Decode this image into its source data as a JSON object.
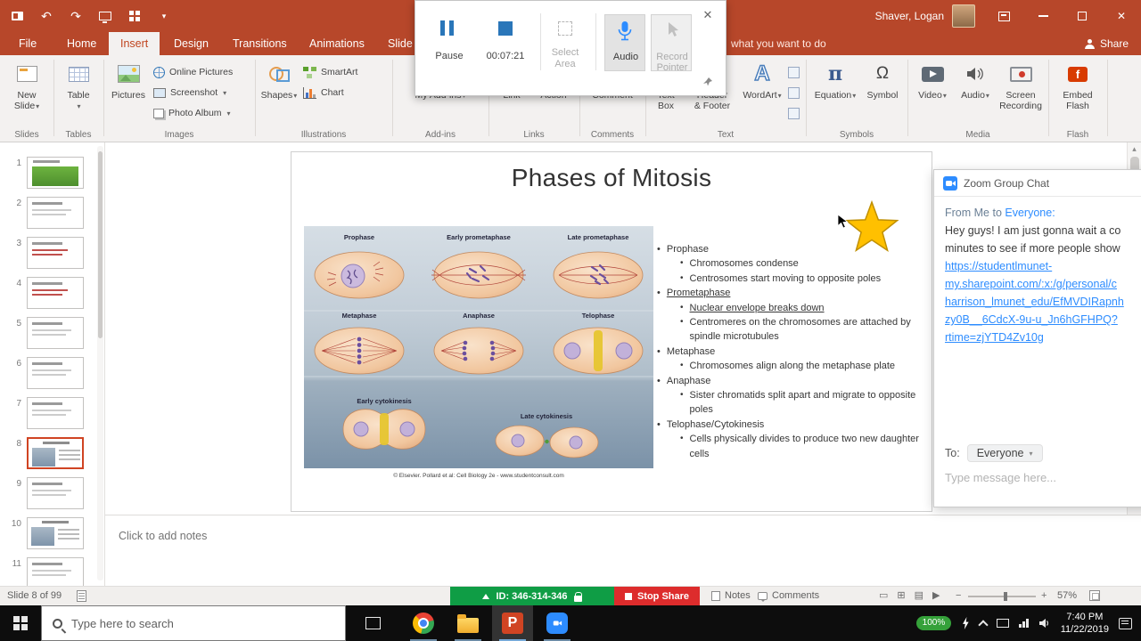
{
  "icons": {
    "close": "✕",
    "dropdown": "▾",
    "undo": "↶",
    "redo": "↷",
    "equation_pi": "π",
    "symbol_omega": "Ω",
    "wordart_a": "A",
    "ppt_p": "P",
    "flash_f": "f",
    "zoom_out": "−",
    "zoom_in": "+",
    "scroll_up": "▴",
    "view_normal": "▭",
    "view_sorter": "⊞",
    "view_reading": "▤",
    "view_slideshow": "▶"
  },
  "titlebar": {
    "user_name": "Shaver, Logan"
  },
  "tabs": {
    "file": "File",
    "home": "Home",
    "insert": "Insert",
    "design": "Design",
    "transitions": "Transitions",
    "animations": "Animations",
    "slideshow": "Slide Show",
    "tellme": "what you want to do",
    "share": "Share"
  },
  "recorder": {
    "pause": "Pause",
    "timer": "00:07:21",
    "select1": "Select",
    "select2": "Area",
    "audio": "Audio",
    "pointer1": "Record",
    "pointer2": "Pointer"
  },
  "ribbon": {
    "slides": {
      "label": "Slides",
      "new1": "New",
      "new2": "Slide"
    },
    "tables": {
      "label": "Tables",
      "table": "Table"
    },
    "images": {
      "label": "Images",
      "pictures": "Pictures",
      "online": "Online Pictures",
      "screenshot": "Screenshot",
      "album": "Photo Album"
    },
    "illustrations": {
      "label": "Illustrations",
      "shapes": "Shapes",
      "smartart": "SmartArt",
      "chart": "Chart"
    },
    "addins": {
      "label": "Add-ins",
      "my_addins": "My Add-ins"
    },
    "links": {
      "label": "Links",
      "link": "Link",
      "action": "Action"
    },
    "comments": {
      "label": "Comments",
      "comment": "Comment"
    },
    "text": {
      "label": "Text",
      "textbox1": "Text",
      "textbox2": "Box",
      "hf1": "Header",
      "hf2": "& Footer",
      "wordart": "WordArt"
    },
    "symbols": {
      "label": "Symbols",
      "equation": "Equation",
      "symbol": "Symbol"
    },
    "media": {
      "label": "Media",
      "video": "Video",
      "audio": "Audio",
      "rec1": "Screen",
      "rec2": "Recording"
    },
    "flash": {
      "label": "Flash",
      "embed1": "Embed",
      "embed2": "Flash"
    }
  },
  "thumbnails": [
    "1",
    "2",
    "3",
    "4",
    "5",
    "6",
    "7",
    "8",
    "9",
    "10",
    "11"
  ],
  "slide": {
    "title": "Phases of Mitosis",
    "figure_labels": {
      "prophase": "Prophase",
      "early_prometaphase": "Early prometaphase",
      "late_prometaphase": "Late prometaphase",
      "metaphase": "Metaphase",
      "anaphase": "Anaphase",
      "telophase": "Telophase",
      "early_cytokinesis": "Early cytokinesis",
      "late_cytokinesis": "Late cytokinesis"
    },
    "figure_caption": "© Elsevier. Pollard et al: Cell Biology 2e - www.studentconsult.com",
    "bullets": [
      {
        "text": "Prophase",
        "sub": [
          "Chromosomes condense",
          "Centrosomes start moving to opposite poles"
        ]
      },
      {
        "text": "Prometaphase",
        "sub": [
          "Nuclear envelope breaks down",
          "Centromeres on the chromosomes are attached by spindle microtubules"
        ]
      },
      {
        "text": "Metaphase",
        "sub": [
          "Chromosomes align along the metaphase plate"
        ]
      },
      {
        "text": "Anaphase",
        "sub": [
          "Sister chromatids split apart and migrate to opposite poles"
        ]
      },
      {
        "text": "Telophase/Cytokinesis",
        "sub": [
          "Cells physically divides to produce two new daughter cells"
        ]
      }
    ]
  },
  "chat": {
    "title": "Zoom Group Chat",
    "from_prefix": "From Me to",
    "from_target": "Everyone:",
    "message_lines": [
      "Hey guys! I am just gonna wait a co",
      "minutes to see if more people show"
    ],
    "link_lines": [
      "https://studentlmunet-",
      "my.sharepoint.com/:x:/g/personal/c",
      "harrison_lmunet_edu/EfMVDIRapnh",
      "zy0B__6CdcX-9u-u_Jn6hGFHPQ?",
      "rtime=zjYTD4Zv10g"
    ],
    "to_label": "To:",
    "to_value": "Everyone",
    "input_placeholder": "Type message here..."
  },
  "notes": {
    "placeholder": "Click to add notes"
  },
  "statusbar": {
    "slide_indicator": "Slide 8 of 99",
    "meeting_id": "ID: 346-314-346",
    "stop_share": "Stop Share",
    "notes": "Notes",
    "comments": "Comments",
    "zoom_level": "57%"
  },
  "taskbar": {
    "search_placeholder": "Type here to search",
    "battery": "100%",
    "time": "7:40 PM",
    "date": "11/22/2019"
  }
}
